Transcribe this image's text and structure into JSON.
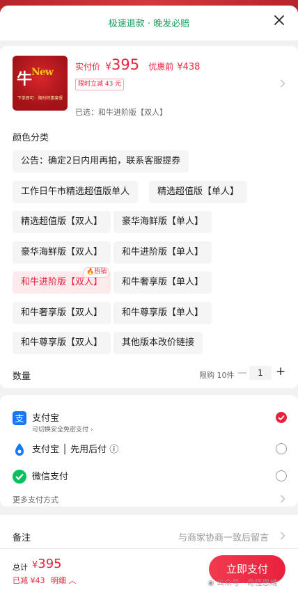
{
  "header": {
    "title": "极速退款 · 晚发必赔"
  },
  "product": {
    "price_label": "实付价",
    "currency": "¥",
    "price": "395",
    "orig_label": "优惠前",
    "orig_price": "¥438",
    "discount": "限时立减 43 元",
    "selected": "已选：和牛进阶版【双人】",
    "thumb_logo": "牛",
    "thumb_logo_small": "New",
    "thumb_caption": "下单即可 · 限时特惠套餐"
  },
  "variants": {
    "title": "颜色分类",
    "hot_badge": "热销",
    "chips": [
      "公告：确定2日内用再拍，联系客服提券",
      "工作日午市精选超值版单人",
      "精选超值版【单人】",
      "精选超值版【双人】",
      "豪华海鲜版【单人】",
      "豪华海鲜版【双人】",
      "和牛进阶版【单人】",
      "和牛进阶版【双人】",
      "和牛奢享版【单人】",
      "和牛奢享版【双人】",
      "和牛尊享版【单人】",
      "和牛尊享版【双人】",
      "其他版本改价链接"
    ]
  },
  "quantity": {
    "label": "数量",
    "limit": "限购 10件",
    "minus": "—",
    "value": "1",
    "plus": "+"
  },
  "payment": {
    "methods": [
      {
        "name": "支付宝",
        "sub": "可切换安全免密支付 ›",
        "icon": "alipay-icon"
      },
      {
        "name": "支付宝 │ 先用后付 ⓘ",
        "icon": "alipay-later-icon"
      },
      {
        "name": "微信支付",
        "icon": "wechat-pay-icon"
      }
    ],
    "more": "更多支付方式"
  },
  "note": {
    "label": "备注",
    "placeholder": "与商家协商一致后留言"
  },
  "footer": {
    "total_label": "总计",
    "currency": "¥",
    "total": "395",
    "saved": "已减 ¥43",
    "detail": "明细 ︿",
    "pay_button": "立即支付",
    "watermark": "公众号 · 奇怪思维"
  },
  "colors": {
    "accent": "#e8213c",
    "green": "#1a9c5b",
    "alipay": "#1677ff",
    "wechat": "#07c160"
  }
}
